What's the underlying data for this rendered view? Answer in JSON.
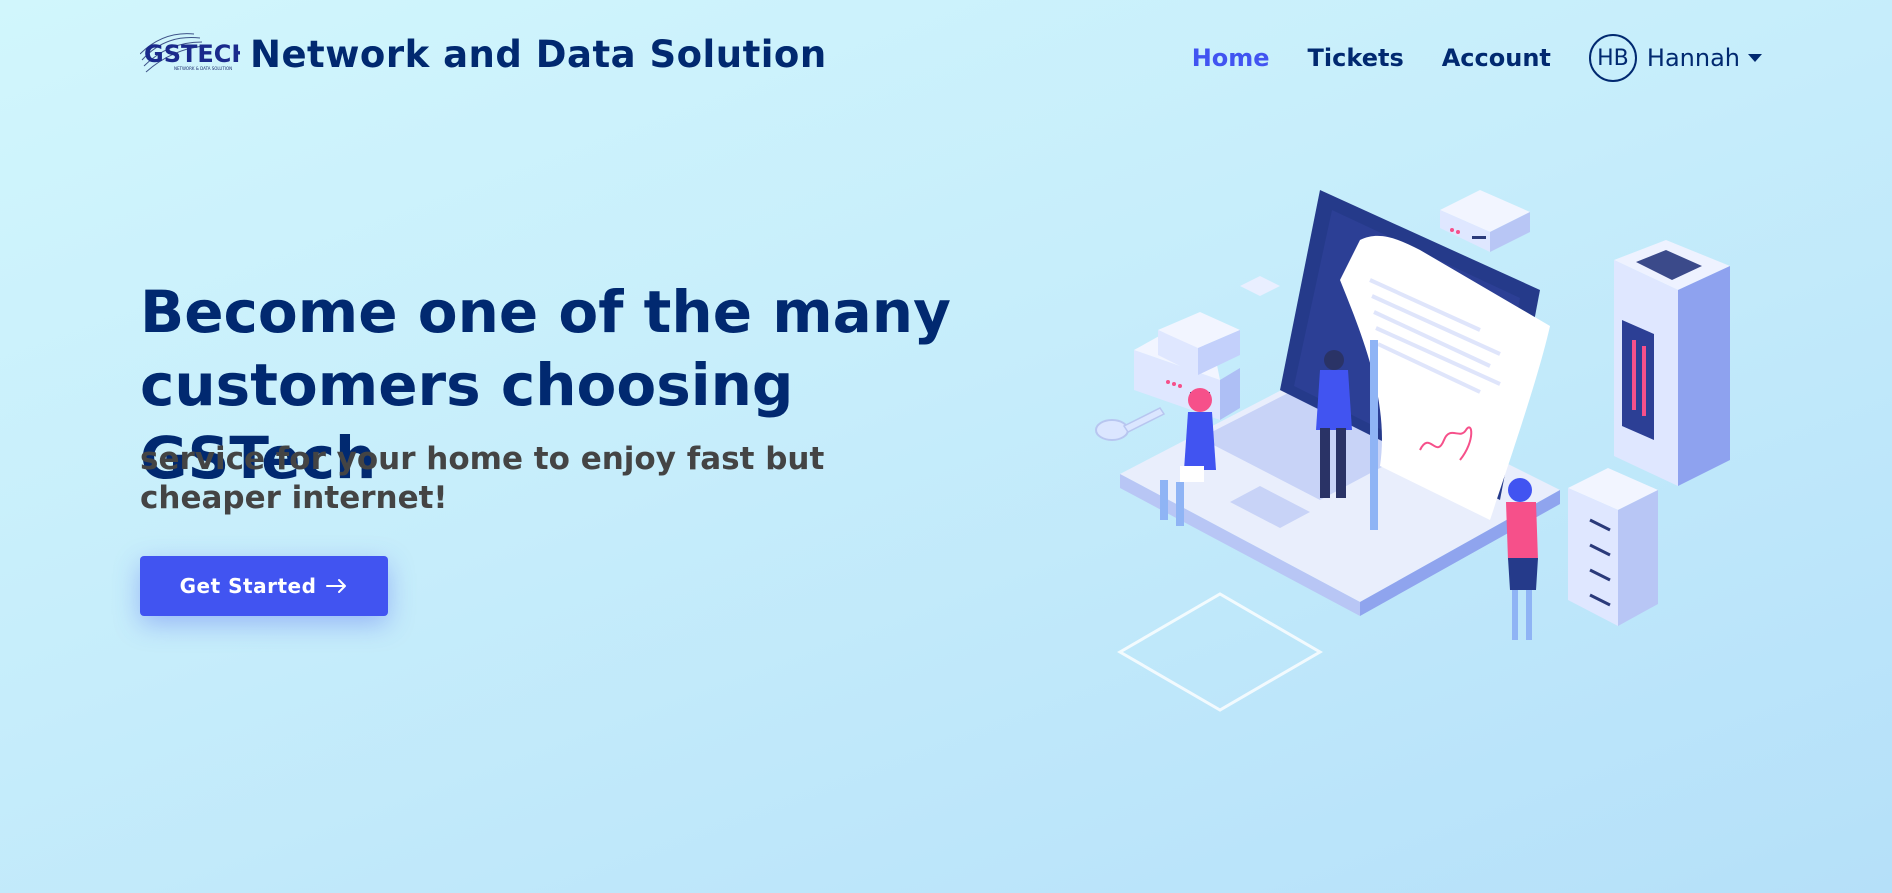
{
  "header": {
    "logo_text": "GSTECH",
    "logo_subtext": "NETWORK & DATA SOLUTION",
    "brand_title": "Network and Data Solution",
    "nav": [
      {
        "label": "Home",
        "active": true
      },
      {
        "label": "Tickets",
        "active": false
      },
      {
        "label": "Account",
        "active": false
      }
    ],
    "user": {
      "initials": "HB",
      "name": "Hannah"
    }
  },
  "hero": {
    "title": "Become one of the many customers choosing GSTech",
    "subtitle": "service for your home to enjoy fast but cheaper internet!",
    "cta_label": "Get Started",
    "illustration": "isometric-laptop-servers-illustration"
  },
  "colors": {
    "primary": "#012970",
    "accent": "#4154f1",
    "subtitle": "#444444",
    "pink": "#f6508a"
  }
}
